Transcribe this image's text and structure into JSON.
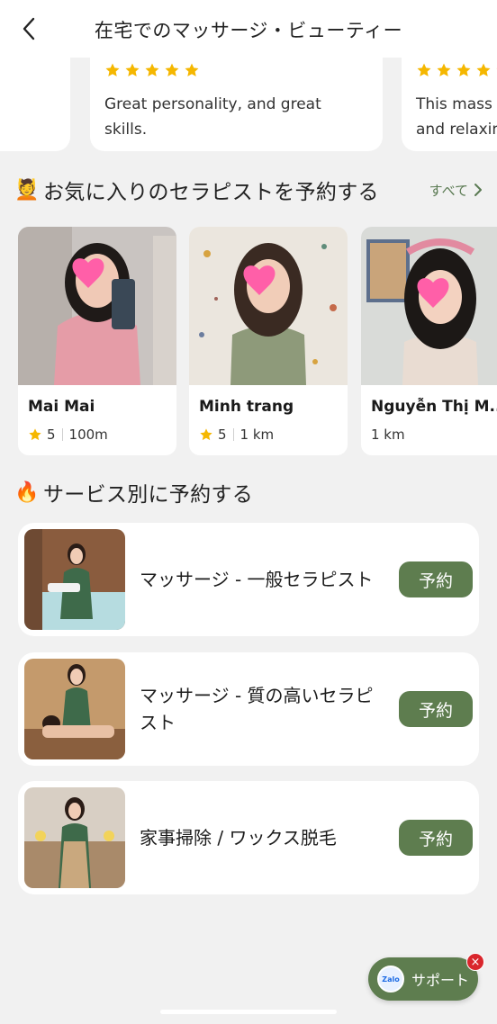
{
  "header": {
    "title": "在宅でのマッサージ・ビューティー"
  },
  "reviews": [
    {
      "rating": 5,
      "text": ""
    },
    {
      "rating": 5,
      "text": "Great personality, and great\nskills."
    },
    {
      "rating": 5,
      "text": "This mass\nand relaxin"
    }
  ],
  "favorites": {
    "emoji": "💆",
    "title": "お気に入りのセラピストを予約する",
    "see_all": "すべて",
    "therapists": [
      {
        "name": "Mai Mai",
        "rating": "5",
        "distance": "100m"
      },
      {
        "name": "Minh trang",
        "rating": "5",
        "distance": "1 km"
      },
      {
        "name": "Nguyễn Thị M...",
        "rating": "",
        "distance": "1 km"
      }
    ]
  },
  "services": {
    "emoji": "🔥",
    "title": "サービス別に予約する",
    "items": [
      {
        "title": "マッサージ - 一般セラピスト",
        "button": "予約"
      },
      {
        "title": "マッサージ - 質の高いセラピスト",
        "button": "予約"
      },
      {
        "title": "家事掃除 / ワックス脱毛",
        "button": "予約"
      }
    ]
  },
  "support": {
    "label": "サポート",
    "zalo": "Zalo",
    "close": "×"
  },
  "colors": {
    "accent": "#5e7d4f",
    "star": "#f5b700",
    "badge": "#d9262c"
  }
}
